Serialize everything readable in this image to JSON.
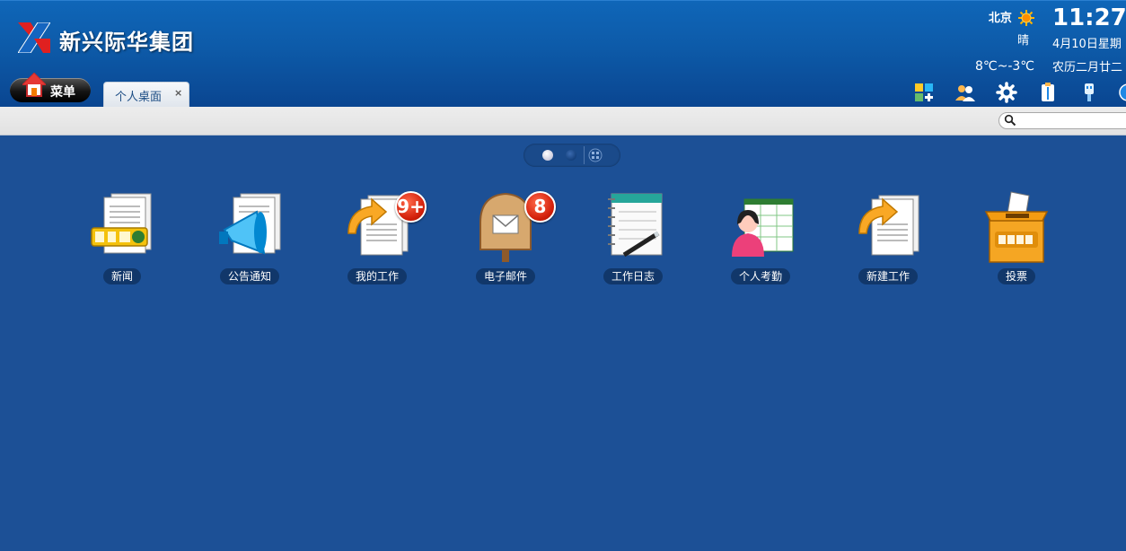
{
  "header": {
    "company_name": "新兴际华集团",
    "weather": {
      "city": "北京",
      "condition": "晴",
      "temp_range": "8℃~-3℃"
    },
    "clock": {
      "time": "11:27",
      "date": "4月10日星期",
      "lunar": "农历二月廿二"
    }
  },
  "nav": {
    "menu_label": "菜单",
    "tabs": [
      {
        "label": "个人桌面",
        "close": "×"
      }
    ],
    "toolbar_icons": [
      "add-widget-icon",
      "users-icon",
      "gear-icon",
      "clipboard-icon",
      "usb-icon",
      "more-icon"
    ]
  },
  "search": {
    "placeholder": ""
  },
  "pager": {
    "pages": 2,
    "current": 1
  },
  "apps": [
    {
      "label": "新闻",
      "icon": "news-icon",
      "badge": ""
    },
    {
      "label": "公告通知",
      "icon": "megaphone-icon",
      "badge": ""
    },
    {
      "label": "我的工作",
      "icon": "my-work-icon",
      "badge": "9+"
    },
    {
      "label": "电子邮件",
      "icon": "mailbox-icon",
      "badge": "8"
    },
    {
      "label": "工作日志",
      "icon": "calendar-pen-icon",
      "badge": ""
    },
    {
      "label": "个人考勤",
      "icon": "attendance-icon",
      "badge": ""
    },
    {
      "label": "新建工作",
      "icon": "new-work-icon",
      "badge": ""
    },
    {
      "label": "投票",
      "icon": "vote-box-icon",
      "badge": ""
    }
  ],
  "colors": {
    "desktop_bg": "#1c5096",
    "header_bg": "#0d5aa8",
    "label_bg": "#11376a",
    "badge_red": "#d21f0a",
    "logo_red": "#e02020"
  }
}
